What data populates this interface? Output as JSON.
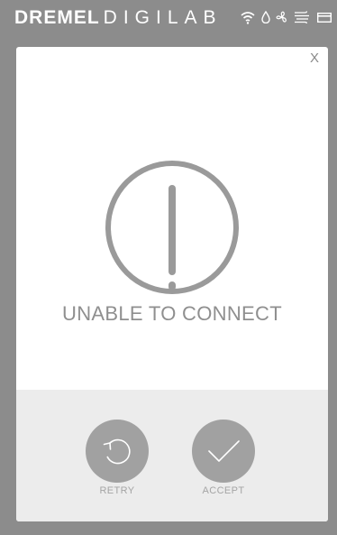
{
  "header": {
    "brand_bold": "DREMEL",
    "brand_light": "DIGILAB",
    "status_icons": [
      "wifi-icon",
      "drop-icon",
      "fan-icon",
      "airflow-icon",
      "card-icon"
    ]
  },
  "dialog": {
    "close_label": "X",
    "icon": "exclamation-circle-icon",
    "message": "UNABLE TO CONNECT",
    "actions": [
      {
        "label": "RETRY",
        "icon": "retry-icon"
      },
      {
        "label": "ACCEPT",
        "icon": "check-icon"
      }
    ]
  },
  "colors": {
    "chrome": "#8c8c8c",
    "dialog_bg": "#ffffff",
    "footer_bg": "#ececec",
    "button_bg": "#a1a1a1",
    "icon_gray": "#9a9a9a"
  }
}
